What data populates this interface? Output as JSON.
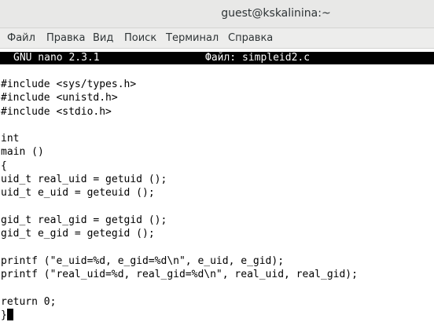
{
  "window": {
    "title": "guest@kskalinina:~"
  },
  "menu": {
    "items": [
      "Файл",
      "Правка",
      "Вид",
      "Поиск",
      "Терминал",
      "Справка"
    ]
  },
  "nano": {
    "version_label": "GNU nano 2.3.1",
    "file_label": "Файл: simpleid2.c"
  },
  "code_lines": [
    "#include <sys/types.h>",
    "#include <unistd.h>",
    "#include <stdio.h>",
    "",
    "int",
    "main ()",
    "{",
    "uid_t real_uid = getuid ();",
    "uid_t e_uid = geteuid ();",
    "",
    "gid_t real_gid = getgid ();",
    "gid_t e_gid = getegid ();",
    "",
    "printf (\"e_uid=%d, e_gid=%d\\n\", e_uid, e_gid);",
    "printf (\"real_uid=%d, real_gid=%d\\n\", real_uid, real_gid);",
    "",
    "return 0;",
    "}"
  ]
}
